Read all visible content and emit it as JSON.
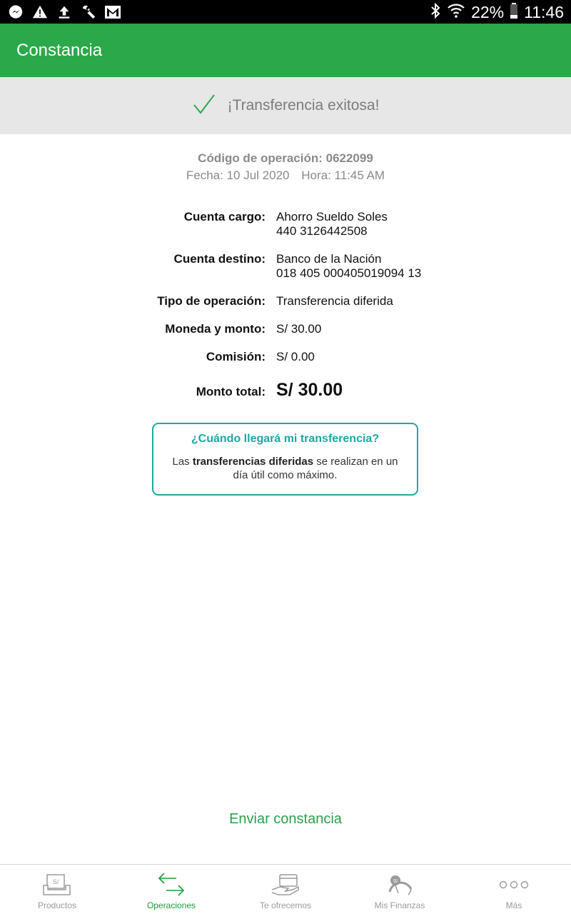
{
  "status_bar": {
    "battery": "22%",
    "time": "11:46",
    "icons": [
      "messenger-icon",
      "warning-icon",
      "upload-icon",
      "wrench-icon",
      "gmail-icon",
      "bluetooth-icon",
      "wifi-icon",
      "battery-icon"
    ]
  },
  "app_bar": {
    "title": "Constancia"
  },
  "banner": {
    "message": "¡Transferencia exitosa!",
    "icon": "check-icon"
  },
  "operation": {
    "code": "Código de operación: 0622099",
    "date": "Fecha: 10 Jul 2020",
    "time": "Hora: 11:45 AM"
  },
  "details": {
    "cargo_label": "Cuenta cargo:",
    "cargo_line1": "Ahorro Sueldo Soles",
    "cargo_line2": "440 3126442508",
    "destino_label": "Cuenta destino:",
    "destino_line1": "Banco de la Nación",
    "destino_line2": "018 405 000405019094 13",
    "tipo_label": "Tipo de operación:",
    "tipo_value": "Transferencia diferida",
    "moneda_label": "Moneda y monto:",
    "moneda_value": "S/ 30.00",
    "comision_label": "Comisión:",
    "comision_value": "S/ 0.00",
    "total_label": "Monto total:",
    "total_value": "S/ 30.00"
  },
  "info_box": {
    "title": "¿Cuándo llegará mi transferencia?",
    "body_pre": "Las ",
    "body_bold": "transferencias diferidas",
    "body_post": " se realizan en un día útil como máximo."
  },
  "send_button": "Enviar constancia",
  "bottom_nav": [
    {
      "label": "Productos",
      "icon": "products-icon",
      "active": false
    },
    {
      "label": "Operaciones",
      "icon": "transfer-arrows-icon",
      "active": true
    },
    {
      "label": "Te ofrecemos",
      "icon": "card-offer-icon",
      "active": false
    },
    {
      "label": "Mis Finanzas",
      "icon": "finance-gauge-icon",
      "active": false
    },
    {
      "label": "Más",
      "icon": "more-dots-icon",
      "active": false
    }
  ],
  "colors": {
    "primary_green": "#2ba84a",
    "teal": "#1ea8a0",
    "banner_bg": "#e7e7e7"
  }
}
